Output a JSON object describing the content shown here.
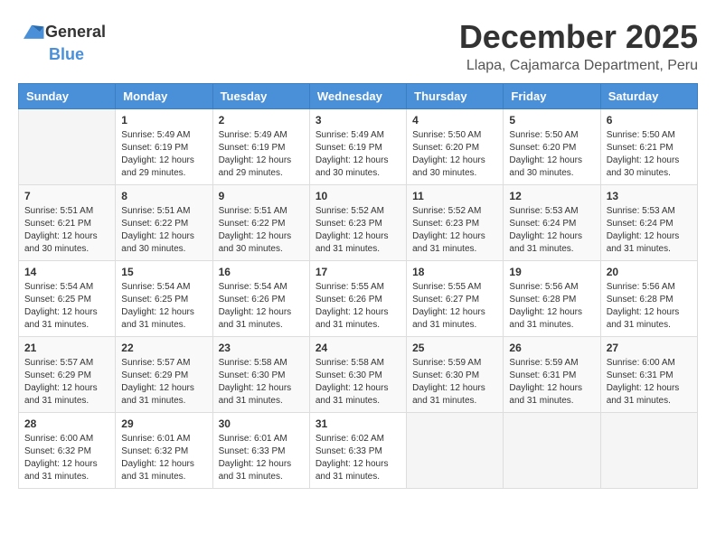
{
  "header": {
    "logo_general": "General",
    "logo_blue": "Blue",
    "month_title": "December 2025",
    "location": "Llapa, Cajamarca Department, Peru"
  },
  "weekdays": [
    "Sunday",
    "Monday",
    "Tuesday",
    "Wednesday",
    "Thursday",
    "Friday",
    "Saturday"
  ],
  "weeks": [
    [
      {
        "day": "",
        "sunrise": "",
        "sunset": "",
        "daylight": ""
      },
      {
        "day": "1",
        "sunrise": "Sunrise: 5:49 AM",
        "sunset": "Sunset: 6:19 PM",
        "daylight": "Daylight: 12 hours and 29 minutes."
      },
      {
        "day": "2",
        "sunrise": "Sunrise: 5:49 AM",
        "sunset": "Sunset: 6:19 PM",
        "daylight": "Daylight: 12 hours and 29 minutes."
      },
      {
        "day": "3",
        "sunrise": "Sunrise: 5:49 AM",
        "sunset": "Sunset: 6:19 PM",
        "daylight": "Daylight: 12 hours and 30 minutes."
      },
      {
        "day": "4",
        "sunrise": "Sunrise: 5:50 AM",
        "sunset": "Sunset: 6:20 PM",
        "daylight": "Daylight: 12 hours and 30 minutes."
      },
      {
        "day": "5",
        "sunrise": "Sunrise: 5:50 AM",
        "sunset": "Sunset: 6:20 PM",
        "daylight": "Daylight: 12 hours and 30 minutes."
      },
      {
        "day": "6",
        "sunrise": "Sunrise: 5:50 AM",
        "sunset": "Sunset: 6:21 PM",
        "daylight": "Daylight: 12 hours and 30 minutes."
      }
    ],
    [
      {
        "day": "7",
        "sunrise": "Sunrise: 5:51 AM",
        "sunset": "Sunset: 6:21 PM",
        "daylight": "Daylight: 12 hours and 30 minutes."
      },
      {
        "day": "8",
        "sunrise": "Sunrise: 5:51 AM",
        "sunset": "Sunset: 6:22 PM",
        "daylight": "Daylight: 12 hours and 30 minutes."
      },
      {
        "day": "9",
        "sunrise": "Sunrise: 5:51 AM",
        "sunset": "Sunset: 6:22 PM",
        "daylight": "Daylight: 12 hours and 30 minutes."
      },
      {
        "day": "10",
        "sunrise": "Sunrise: 5:52 AM",
        "sunset": "Sunset: 6:23 PM",
        "daylight": "Daylight: 12 hours and 31 minutes."
      },
      {
        "day": "11",
        "sunrise": "Sunrise: 5:52 AM",
        "sunset": "Sunset: 6:23 PM",
        "daylight": "Daylight: 12 hours and 31 minutes."
      },
      {
        "day": "12",
        "sunrise": "Sunrise: 5:53 AM",
        "sunset": "Sunset: 6:24 PM",
        "daylight": "Daylight: 12 hours and 31 minutes."
      },
      {
        "day": "13",
        "sunrise": "Sunrise: 5:53 AM",
        "sunset": "Sunset: 6:24 PM",
        "daylight": "Daylight: 12 hours and 31 minutes."
      }
    ],
    [
      {
        "day": "14",
        "sunrise": "Sunrise: 5:54 AM",
        "sunset": "Sunset: 6:25 PM",
        "daylight": "Daylight: 12 hours and 31 minutes."
      },
      {
        "day": "15",
        "sunrise": "Sunrise: 5:54 AM",
        "sunset": "Sunset: 6:25 PM",
        "daylight": "Daylight: 12 hours and 31 minutes."
      },
      {
        "day": "16",
        "sunrise": "Sunrise: 5:54 AM",
        "sunset": "Sunset: 6:26 PM",
        "daylight": "Daylight: 12 hours and 31 minutes."
      },
      {
        "day": "17",
        "sunrise": "Sunrise: 5:55 AM",
        "sunset": "Sunset: 6:26 PM",
        "daylight": "Daylight: 12 hours and 31 minutes."
      },
      {
        "day": "18",
        "sunrise": "Sunrise: 5:55 AM",
        "sunset": "Sunset: 6:27 PM",
        "daylight": "Daylight: 12 hours and 31 minutes."
      },
      {
        "day": "19",
        "sunrise": "Sunrise: 5:56 AM",
        "sunset": "Sunset: 6:28 PM",
        "daylight": "Daylight: 12 hours and 31 minutes."
      },
      {
        "day": "20",
        "sunrise": "Sunrise: 5:56 AM",
        "sunset": "Sunset: 6:28 PM",
        "daylight": "Daylight: 12 hours and 31 minutes."
      }
    ],
    [
      {
        "day": "21",
        "sunrise": "Sunrise: 5:57 AM",
        "sunset": "Sunset: 6:29 PM",
        "daylight": "Daylight: 12 hours and 31 minutes."
      },
      {
        "day": "22",
        "sunrise": "Sunrise: 5:57 AM",
        "sunset": "Sunset: 6:29 PM",
        "daylight": "Daylight: 12 hours and 31 minutes."
      },
      {
        "day": "23",
        "sunrise": "Sunrise: 5:58 AM",
        "sunset": "Sunset: 6:30 PM",
        "daylight": "Daylight: 12 hours and 31 minutes."
      },
      {
        "day": "24",
        "sunrise": "Sunrise: 5:58 AM",
        "sunset": "Sunset: 6:30 PM",
        "daylight": "Daylight: 12 hours and 31 minutes."
      },
      {
        "day": "25",
        "sunrise": "Sunrise: 5:59 AM",
        "sunset": "Sunset: 6:30 PM",
        "daylight": "Daylight: 12 hours and 31 minutes."
      },
      {
        "day": "26",
        "sunrise": "Sunrise: 5:59 AM",
        "sunset": "Sunset: 6:31 PM",
        "daylight": "Daylight: 12 hours and 31 minutes."
      },
      {
        "day": "27",
        "sunrise": "Sunrise: 6:00 AM",
        "sunset": "Sunset: 6:31 PM",
        "daylight": "Daylight: 12 hours and 31 minutes."
      }
    ],
    [
      {
        "day": "28",
        "sunrise": "Sunrise: 6:00 AM",
        "sunset": "Sunset: 6:32 PM",
        "daylight": "Daylight: 12 hours and 31 minutes."
      },
      {
        "day": "29",
        "sunrise": "Sunrise: 6:01 AM",
        "sunset": "Sunset: 6:32 PM",
        "daylight": "Daylight: 12 hours and 31 minutes."
      },
      {
        "day": "30",
        "sunrise": "Sunrise: 6:01 AM",
        "sunset": "Sunset: 6:33 PM",
        "daylight": "Daylight: 12 hours and 31 minutes."
      },
      {
        "day": "31",
        "sunrise": "Sunrise: 6:02 AM",
        "sunset": "Sunset: 6:33 PM",
        "daylight": "Daylight: 12 hours and 31 minutes."
      },
      {
        "day": "",
        "sunrise": "",
        "sunset": "",
        "daylight": ""
      },
      {
        "day": "",
        "sunrise": "",
        "sunset": "",
        "daylight": ""
      },
      {
        "day": "",
        "sunrise": "",
        "sunset": "",
        "daylight": ""
      }
    ]
  ]
}
